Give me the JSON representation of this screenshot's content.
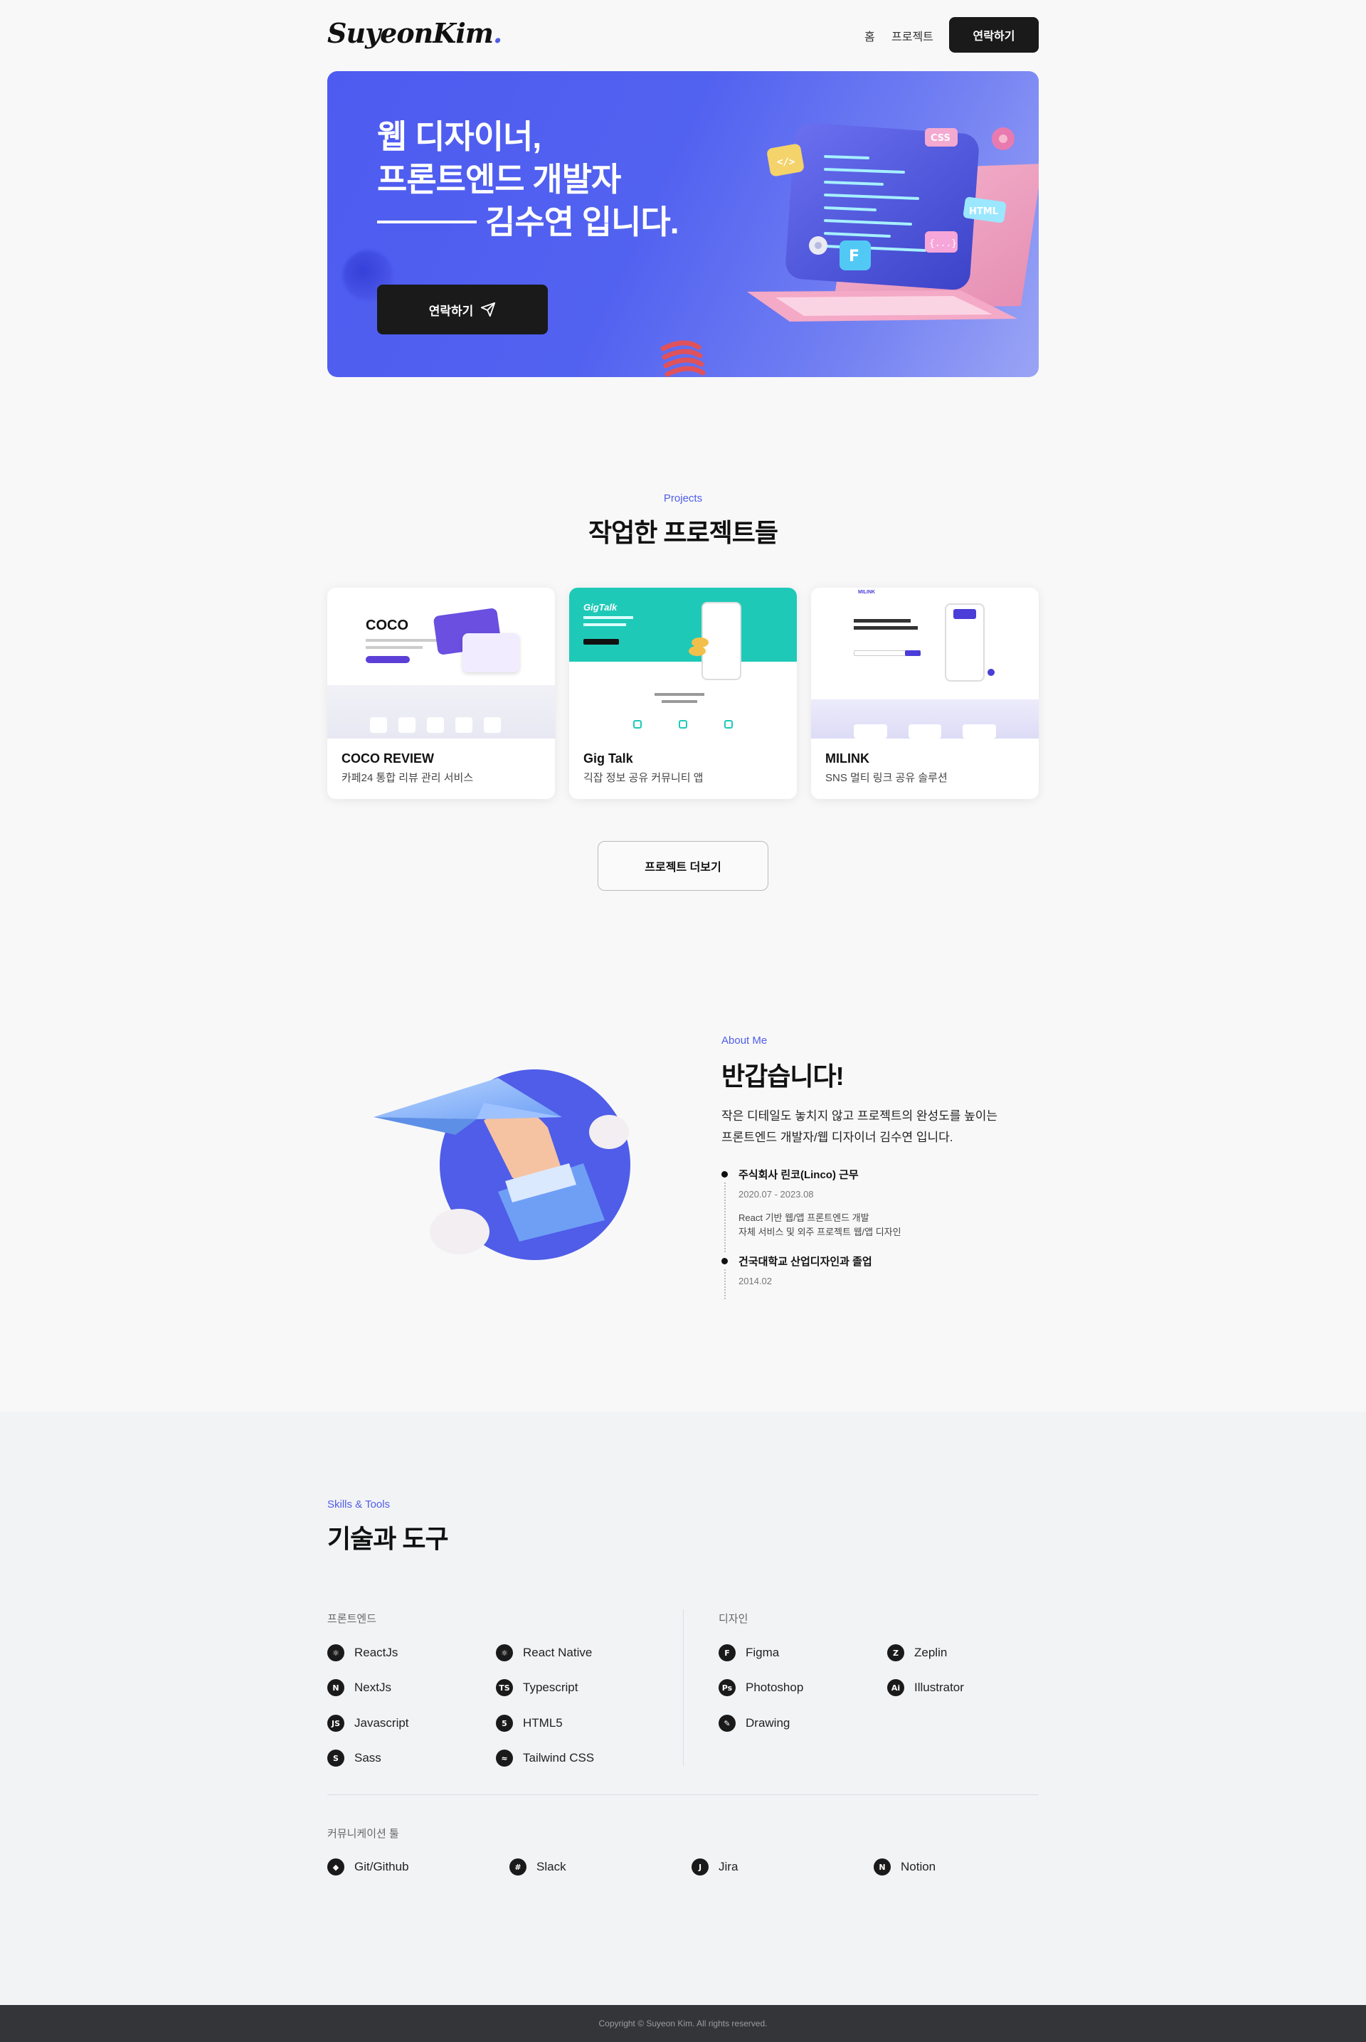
{
  "header": {
    "logo": "SuyeonKim",
    "logo_dot": ".",
    "nav": [
      "홈",
      "프로젝트"
    ],
    "contact_button": "연락하기"
  },
  "hero": {
    "title_line1": "웹 디자이너,",
    "title_line2": "프론트엔드 개발자",
    "title_line3": "김수연 입니다.",
    "cta_label": "연락하기",
    "cta_icon": "send-icon",
    "laptop_tags": [
      "CSS",
      "HTML",
      "</>",
      "{...}"
    ]
  },
  "projects": {
    "eyebrow": "Projects",
    "title": "작업한 프로젝트들",
    "items": [
      {
        "name": "COCO REVIEW",
        "desc": "카페24 통합 리뷰 관리 서비스",
        "thumb_brand": "COCO",
        "accent": "#5b3fd6"
      },
      {
        "name": "Gig Talk",
        "desc": "긱잡 정보 공유 커뮤니티 앱",
        "thumb_brand": "GigTalk",
        "accent": "#1fc9b8"
      },
      {
        "name": "MILINK",
        "desc": "SNS 멀티 링크 공유 솔루션",
        "thumb_brand": "MILINK",
        "accent": "#4a3dd8"
      }
    ],
    "more_button": "프로젝트 더보기"
  },
  "about": {
    "eyebrow": "About Me",
    "title": "반갑습니다!",
    "intro_line1": "작은 디테일도 놓치지 않고 프로젝트의 완성도를 높이는",
    "intro_line2": "프론트엔드 개발자/웹 디자이너 김수연 입니다.",
    "timeline": [
      {
        "title": "주식회사 린코(Linco) 근무",
        "date": "2020.07 - 2023.08",
        "desc": [
          "React 기반 웹/앱 프론트엔드 개발",
          "자체 서비스 및 외주 프로젝트 웹/앱 디자인"
        ]
      },
      {
        "title": "건국대학교 산업디자인과 졸업",
        "date": "2014.02",
        "desc": []
      }
    ]
  },
  "skills": {
    "eyebrow": "Skills & Tools",
    "title": "기술과 도구",
    "frontend_label": "프론트엔드",
    "frontend": [
      {
        "name": "ReactJs",
        "icon": "react-icon",
        "glyph": "⚛"
      },
      {
        "name": "NextJs",
        "icon": "nextjs-icon",
        "glyph": "N"
      },
      {
        "name": "Javascript",
        "icon": "javascript-icon",
        "glyph": "JS"
      },
      {
        "name": "Sass",
        "icon": "sass-icon",
        "glyph": "S"
      },
      {
        "name": "React Native",
        "icon": "react-native-icon",
        "glyph": "⚛"
      },
      {
        "name": "Typescript",
        "icon": "typescript-icon",
        "glyph": "TS"
      },
      {
        "name": "HTML5",
        "icon": "html5-icon",
        "glyph": "5"
      },
      {
        "name": "Tailwind CSS",
        "icon": "tailwind-icon",
        "glyph": "≈"
      }
    ],
    "design_label": "디자인",
    "design": [
      {
        "name": "Figma",
        "icon": "figma-icon",
        "glyph": "F"
      },
      {
        "name": "Photoshop",
        "icon": "photoshop-icon",
        "glyph": "Ps"
      },
      {
        "name": "Drawing",
        "icon": "drawing-icon",
        "glyph": "✎"
      },
      {
        "name": "Zeplin",
        "icon": "zeplin-icon",
        "glyph": "Z"
      },
      {
        "name": "Illustrator",
        "icon": "illustrator-icon",
        "glyph": "Ai"
      }
    ],
    "comm_label": "커뮤니케이션 툴",
    "comm": [
      {
        "name": "Git/Github",
        "icon": "git-icon",
        "glyph": "◆"
      },
      {
        "name": "Slack",
        "icon": "slack-icon",
        "glyph": "#"
      },
      {
        "name": "Jira",
        "icon": "jira-icon",
        "glyph": "J"
      },
      {
        "name": "Notion",
        "icon": "notion-icon",
        "glyph": "N"
      }
    ]
  },
  "footer": {
    "copyright": "Copyright © Suyeon Kim. All rights reserved."
  },
  "colors": {
    "accent": "#4f5de8",
    "dark": "#1a1a1a",
    "footer_bg": "#343539"
  }
}
